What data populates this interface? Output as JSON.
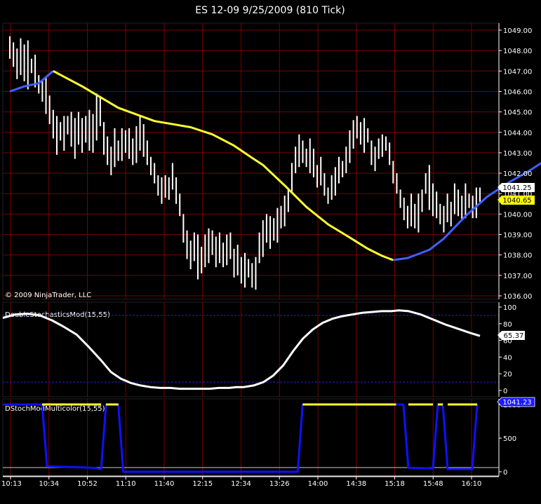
{
  "title": "ES 12-09  9/25/2009 (810 Tick)",
  "copyright": "© 2009 NinjaTrader, LLC",
  "colors": {
    "background": "#000000",
    "grid": "#7a0000",
    "bars": "#ffffff",
    "ma_rising": "#4060ff",
    "ma_falling": "#ffff33",
    "stoch_line": "#ffffff",
    "stoch_levels": "#2222cc",
    "multicolor_blue": "#1010ff",
    "multicolor_yellow": "#ffff33",
    "price_marker_bg": "#ffffff",
    "ma_marker_bg": "#ffff00",
    "stoch_marker_bg": "#ffffff",
    "multicolor_marker_bg": "#1a1aff"
  },
  "x_axis": {
    "labels": [
      "10:13",
      "10:34",
      "10:52",
      "11:10",
      "11:40",
      "12:15",
      "12:34",
      "13:26",
      "14:00",
      "14:38",
      "15:18",
      "15:48",
      "16:10"
    ]
  },
  "chart_data": [
    {
      "type": "line",
      "panel": "price",
      "ylim": [
        1036,
        1049
      ],
      "yticks": [
        "1036.00",
        "1037.00",
        "1038.00",
        "1039.00",
        "1040.00",
        "1041.00",
        "1042.00",
        "1043.00",
        "1044.00",
        "1045.00",
        "1046.00",
        "1047.00",
        "1048.00",
        "1049.00"
      ],
      "markers": {
        "last_price": "1041.25",
        "moving_average": "1040.65"
      },
      "bars_hl": [
        [
          1047.6,
          1048.7
        ],
        [
          1047.2,
          1048.4
        ],
        [
          1046.6,
          1048.1
        ],
        [
          1046.8,
          1048.6
        ],
        [
          1046.5,
          1048.3
        ],
        [
          1046.1,
          1048.5
        ],
        [
          1046.9,
          1047.6
        ],
        [
          1046.2,
          1047.8
        ],
        [
          1045.9,
          1046.8
        ],
        [
          1045.5,
          1046.6
        ],
        [
          1044.9,
          1046.7
        ],
        [
          1044.4,
          1045.8
        ],
        [
          1043.7,
          1045.1
        ],
        [
          1042.9,
          1044.8
        ],
        [
          1043.6,
          1044.5
        ],
        [
          1043.1,
          1044.8
        ],
        [
          1043.9,
          1044.8
        ],
        [
          1043.3,
          1045.0
        ],
        [
          1042.7,
          1044.7
        ],
        [
          1043.4,
          1045.0
        ],
        [
          1043.0,
          1044.7
        ],
        [
          1043.5,
          1044.8
        ],
        [
          1043.1,
          1045.1
        ],
        [
          1043.0,
          1044.9
        ],
        [
          1043.6,
          1045.9
        ],
        [
          1044.3,
          1045.7
        ],
        [
          1042.9,
          1044.5
        ],
        [
          1042.4,
          1043.8
        ],
        [
          1041.9,
          1043.3
        ],
        [
          1042.3,
          1044.2
        ],
        [
          1042.6,
          1043.6
        ],
        [
          1042.6,
          1044.2
        ],
        [
          1043.0,
          1044.1
        ],
        [
          1042.7,
          1044.2
        ],
        [
          1042.4,
          1043.7
        ],
        [
          1042.5,
          1044.3
        ],
        [
          1043.1,
          1044.8
        ],
        [
          1042.8,
          1044.4
        ],
        [
          1042.4,
          1043.6
        ],
        [
          1041.9,
          1042.8
        ],
        [
          1041.5,
          1042.5
        ],
        [
          1040.9,
          1041.9
        ],
        [
          1040.5,
          1041.8
        ],
        [
          1040.8,
          1041.9
        ],
        [
          1040.7,
          1041.8
        ],
        [
          1041.2,
          1042.5
        ],
        [
          1040.5,
          1041.8
        ],
        [
          1039.9,
          1041.0
        ],
        [
          1038.6,
          1040.0
        ],
        [
          1037.8,
          1039.2
        ],
        [
          1037.3,
          1038.7
        ],
        [
          1037.7,
          1039.1
        ],
        [
          1036.8,
          1039.0
        ],
        [
          1037.1,
          1038.4
        ],
        [
          1037.4,
          1039.0
        ],
        [
          1037.6,
          1039.3
        ],
        [
          1038.0,
          1039.2
        ],
        [
          1037.4,
          1038.9
        ],
        [
          1037.6,
          1039.1
        ],
        [
          1037.4,
          1038.6
        ],
        [
          1037.5,
          1039.0
        ],
        [
          1037.8,
          1039.1
        ],
        [
          1036.9,
          1038.3
        ],
        [
          1037.0,
          1038.5
        ],
        [
          1036.6,
          1037.9
        ],
        [
          1036.4,
          1038.1
        ],
        [
          1036.9,
          1037.8
        ],
        [
          1036.4,
          1037.6
        ],
        [
          1036.3,
          1037.9
        ],
        [
          1037.6,
          1039.1
        ],
        [
          1037.9,
          1039.7
        ],
        [
          1038.6,
          1040.0
        ],
        [
          1038.3,
          1039.9
        ],
        [
          1038.7,
          1039.8
        ],
        [
          1038.6,
          1040.3
        ],
        [
          1039.3,
          1040.4
        ],
        [
          1039.4,
          1040.9
        ],
        [
          1040.1,
          1041.2
        ],
        [
          1041.1,
          1042.5
        ],
        [
          1042.0,
          1043.3
        ],
        [
          1042.3,
          1043.9
        ],
        [
          1042.5,
          1043.6
        ],
        [
          1042.3,
          1043.2
        ],
        [
          1042.0,
          1043.7
        ],
        [
          1041.8,
          1043.2
        ],
        [
          1041.3,
          1042.4
        ],
        [
          1041.4,
          1042.8
        ],
        [
          1040.9,
          1042.0
        ],
        [
          1040.5,
          1041.3
        ],
        [
          1040.7,
          1041.9
        ],
        [
          1040.9,
          1042.3
        ],
        [
          1041.5,
          1042.8
        ],
        [
          1041.8,
          1042.6
        ],
        [
          1042.0,
          1043.3
        ],
        [
          1042.5,
          1044.1
        ],
        [
          1043.2,
          1044.6
        ],
        [
          1043.7,
          1044.8
        ],
        [
          1043.4,
          1044.5
        ],
        [
          1043.0,
          1044.7
        ],
        [
          1043.5,
          1044.2
        ],
        [
          1042.4,
          1043.6
        ],
        [
          1042.1,
          1043.3
        ],
        [
          1042.7,
          1043.7
        ],
        [
          1042.8,
          1043.9
        ],
        [
          1043.1,
          1043.8
        ],
        [
          1042.4,
          1043.5
        ],
        [
          1041.5,
          1042.6
        ],
        [
          1041.0,
          1042.0
        ],
        [
          1040.3,
          1041.2
        ],
        [
          1039.7,
          1040.8
        ],
        [
          1039.3,
          1040.4
        ],
        [
          1039.4,
          1041.0
        ],
        [
          1039.3,
          1040.5
        ],
        [
          1039.1,
          1041.0
        ],
        [
          1040.1,
          1041.2
        ],
        [
          1041.0,
          1042.0
        ],
        [
          1040.2,
          1042.4
        ],
        [
          1039.9,
          1041.5
        ],
        [
          1039.8,
          1041.1
        ],
        [
          1039.5,
          1040.5
        ],
        [
          1039.1,
          1040.4
        ],
        [
          1039.6,
          1041.0
        ],
        [
          1039.4,
          1040.6
        ],
        [
          1040.0,
          1041.5
        ],
        [
          1039.9,
          1041.2
        ],
        [
          1039.7,
          1040.9
        ],
        [
          1039.8,
          1041.5
        ],
        [
          1040.3,
          1041.0
        ],
        [
          1039.8,
          1040.9
        ],
        [
          1039.8,
          1041.3
        ],
        [
          1040.6,
          1041.3
        ]
      ],
      "ma_points": [
        [
          0,
          1046.0
        ],
        [
          4,
          1046.25
        ],
        [
          8,
          1046.4
        ],
        [
          12,
          1047.0
        ],
        [
          20,
          1046.25
        ],
        [
          30,
          1045.2
        ],
        [
          40,
          1044.55
        ],
        [
          50,
          1044.25
        ],
        [
          56,
          1043.9
        ],
        [
          62,
          1043.35
        ],
        [
          67,
          1042.75
        ],
        [
          70,
          1042.4
        ],
        [
          76,
          1041.4
        ],
        [
          82,
          1040.35
        ],
        [
          88,
          1039.5
        ],
        [
          94,
          1038.85
        ],
        [
          99,
          1038.3
        ],
        [
          103,
          1037.95
        ],
        [
          106,
          1037.75
        ],
        [
          110,
          1037.85
        ],
        [
          116,
          1038.25
        ],
        [
          120,
          1038.8
        ],
        [
          126,
          1039.9
        ],
        [
          132,
          1040.85
        ],
        [
          138,
          1041.55
        ],
        [
          143,
          1042.05
        ],
        [
          147,
          1042.5
        ],
        [
          150,
          1042.75
        ],
        [
          154,
          1042.85
        ],
        [
          158,
          1042.85
        ],
        [
          162,
          1042.7
        ],
        [
          166,
          1042.4
        ],
        [
          170,
          1042.1
        ],
        [
          174,
          1041.75
        ],
        [
          178,
          1041.3
        ],
        [
          182,
          1040.9
        ],
        [
          185,
          1040.65
        ]
      ],
      "ma_turn_up": 106,
      "ma_turn_down": 156
    },
    {
      "type": "line",
      "panel": "stochastic",
      "title": "DoubleStochasticsMod(15,55)",
      "ylim": [
        0,
        100
      ],
      "yticks": [
        "100",
        "80",
        "60",
        "40",
        "20",
        "0"
      ],
      "levels": [
        10,
        90
      ],
      "last_value": "65.37",
      "points": [
        [
          0,
          87
        ],
        [
          5,
          91
        ],
        [
          10,
          92
        ],
        [
          15,
          90
        ],
        [
          20,
          84
        ],
        [
          25,
          76
        ],
        [
          30,
          67
        ],
        [
          35,
          52
        ],
        [
          40,
          36
        ],
        [
          44,
          22
        ],
        [
          48,
          14
        ],
        [
          52,
          9
        ],
        [
          56,
          6
        ],
        [
          60,
          4
        ],
        [
          64,
          3
        ],
        [
          68,
          3
        ],
        [
          72,
          2
        ],
        [
          76,
          2
        ],
        [
          80,
          2
        ],
        [
          84,
          2
        ],
        [
          88,
          3
        ],
        [
          92,
          3
        ],
        [
          95,
          4
        ],
        [
          98,
          4
        ],
        [
          102,
          6
        ],
        [
          106,
          10
        ],
        [
          110,
          18
        ],
        [
          114,
          30
        ],
        [
          118,
          47
        ],
        [
          122,
          62
        ],
        [
          126,
          73
        ],
        [
          130,
          81
        ],
        [
          134,
          86
        ],
        [
          138,
          89
        ],
        [
          142,
          91
        ],
        [
          146,
          93
        ],
        [
          150,
          94
        ],
        [
          154,
          95
        ],
        [
          158,
          95
        ],
        [
          161,
          96
        ],
        [
          165,
          95
        ],
        [
          170,
          91
        ],
        [
          175,
          85
        ],
        [
          180,
          79
        ],
        [
          185,
          74
        ],
        [
          190,
          69
        ],
        [
          194,
          65.37
        ]
      ]
    },
    {
      "type": "line",
      "panel": "multicolor",
      "title": "DStochModMulticolor(15,55)",
      "ylim": [
        -20,
        1100
      ],
      "yticks": [
        "1000",
        "500",
        "0"
      ],
      "last_value": "1041.23",
      "blue_points": [
        [
          0,
          1000
        ],
        [
          16,
          1000
        ],
        [
          18,
          80
        ],
        [
          36,
          60
        ],
        [
          40,
          40
        ],
        [
          42,
          1000
        ],
        [
          47,
          1000
        ],
        [
          49,
          0
        ],
        [
          70,
          0
        ],
        [
          90,
          0
        ],
        [
          110,
          0
        ],
        [
          120,
          0
        ],
        [
          122,
          1000
        ],
        [
          143,
          1000
        ],
        [
          163,
          1000
        ],
        [
          165,
          60
        ],
        [
          175,
          50
        ],
        [
          177,
          1000
        ],
        [
          179,
          1000
        ],
        [
          181,
          40
        ],
        [
          191,
          40
        ],
        [
          193,
          1000
        ]
      ],
      "yellow_segments": [
        [
          [
            16,
            1000
          ],
          [
            40,
            1000
          ]
        ],
        [
          [
            42,
            1000
          ],
          [
            47,
            1000
          ]
        ],
        [
          [
            122,
            1000
          ],
          [
            160,
            1000
          ]
        ],
        [
          [
            165,
            1000
          ],
          [
            175,
            1000
          ]
        ],
        [
          [
            177,
            1000
          ],
          [
            179,
            1000
          ]
        ],
        [
          [
            181,
            1000
          ],
          [
            193,
            1000
          ]
        ]
      ]
    }
  ]
}
